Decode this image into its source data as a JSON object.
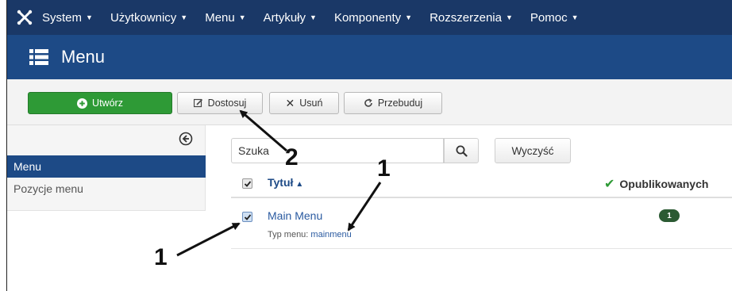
{
  "topnav": {
    "items": [
      {
        "label": "System"
      },
      {
        "label": "Użytkownicy"
      },
      {
        "label": "Menu"
      },
      {
        "label": "Artykuły"
      },
      {
        "label": "Komponenty"
      },
      {
        "label": "Rozszerzenia"
      },
      {
        "label": "Pomoc"
      }
    ]
  },
  "header": {
    "title": "Menu"
  },
  "toolbar": {
    "new_label": "Utwórz",
    "customize_label": "Dostosuj",
    "delete_label": "Usuń",
    "rebuild_label": "Przebuduj"
  },
  "sidebar": {
    "items": [
      {
        "label": "Menu",
        "active": true
      },
      {
        "label": "Pozycje menu",
        "active": false
      }
    ]
  },
  "filter": {
    "search_value": "Szuka",
    "clear_label": "Wyczyść"
  },
  "table": {
    "col_title": "Tytuł",
    "col_published": "Opublikowanych",
    "rows": [
      {
        "name": "Main Menu",
        "type_prefix": "Typ menu:",
        "type_value": "mainmenu",
        "published": "1"
      }
    ]
  },
  "annotations": {
    "one_a": "1",
    "one_b": "1",
    "two": "2"
  },
  "colors": {
    "topnav_bg": "#1a3867",
    "titlebar_bg": "#1d4a86",
    "new_button": "#2e9a36",
    "badge": "#2b5a33"
  }
}
